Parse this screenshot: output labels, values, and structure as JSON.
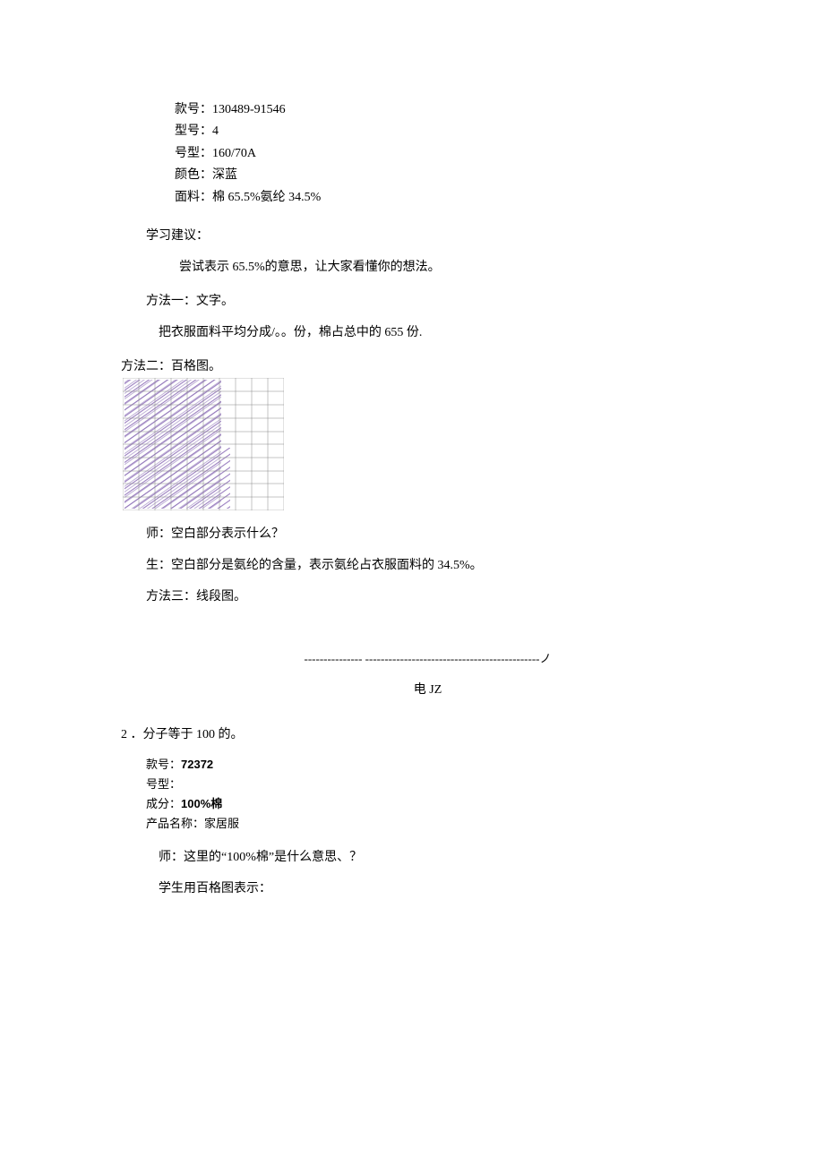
{
  "labelBlock1": {
    "l1_label": "款号：",
    "l1_value": "130489-91546",
    "l2_label": "型号：",
    "l2_value": "4",
    "l3_label": "号型：",
    "l3_value": "160/70A",
    "l4_label": "颜色：",
    "l4_value": "深蓝",
    "l5_label": "面料：",
    "l5_value": "棉 65.5%氨纶 34.5%"
  },
  "studyAdvice": {
    "heading": "学习建议：",
    "text": "尝试表示 65.5%的意思，让大家看懂你的想法。"
  },
  "method1": {
    "heading": "方法一：文字。",
    "text": "把衣服面料平均分成/。。份，棉占总中的 655 份."
  },
  "method2": {
    "heading": "方法二：百格图。",
    "q_label": "师：",
    "q_text": "空白部分表示什么？",
    "a_label": "生：",
    "a_text": "空白部分是氨纶的含量，表示氨纶占衣服面料的 34.5%。"
  },
  "method3": {
    "heading": "方法三：线段图。",
    "dashline": "--------------- ---------------------------------------------ノ",
    "caption": "电 JZ"
  },
  "section2": {
    "heading": "2 ．分子等于 100 的。"
  },
  "labelBlock2": {
    "l1_label": "款号：",
    "l1_value": "72372",
    "l2_label": "号型：",
    "l2_value": "",
    "l3_label": "成分：",
    "l3_value": "100%棉",
    "l4_label": "产品名称：",
    "l4_value": "家居服"
  },
  "question2": {
    "q_label": "师：",
    "q_text": "这里的“100%棉”是什么意思、？",
    "a_text": "学生用百格图表示："
  }
}
